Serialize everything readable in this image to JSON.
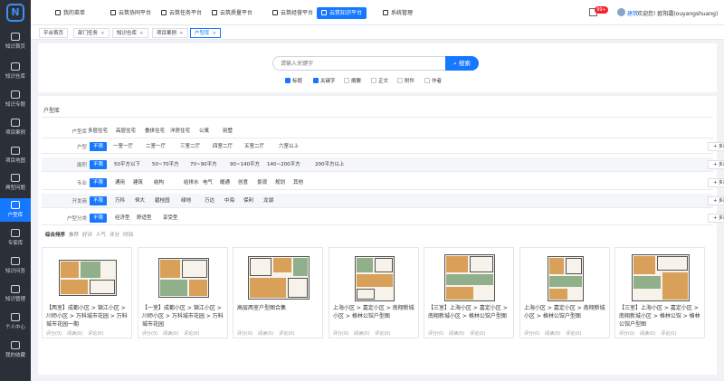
{
  "sidebar": {
    "logo": "N",
    "items": [
      {
        "label": "知识首页",
        "icon": "home-icon"
      },
      {
        "label": "知识仓库",
        "icon": "warehouse-icon"
      },
      {
        "label": "知识专题",
        "icon": "topic-icon"
      },
      {
        "label": "项目案例",
        "icon": "case-icon"
      },
      {
        "label": "项目地图",
        "icon": "map-icon"
      },
      {
        "label": "典型问题",
        "icon": "question-icon"
      },
      {
        "label": "户型库",
        "icon": "floorplan-icon",
        "active": true
      },
      {
        "label": "专家库",
        "icon": "expert-icon"
      },
      {
        "label": "知识问答",
        "icon": "qa-icon"
      },
      {
        "label": "知识管理",
        "icon": "manage-icon"
      },
      {
        "label": "个人中心",
        "icon": "user-icon"
      },
      {
        "label": "我的收藏",
        "icon": "favorite-icon"
      }
    ]
  },
  "topbar": {
    "tabs": [
      {
        "label": "我的菜单"
      },
      {
        "label": "云筑协同平台"
      },
      {
        "label": "云筑任务平台"
      },
      {
        "label": "云筑质量平台"
      },
      {
        "label": "云筑经营平台"
      },
      {
        "label": "云筑知识平台",
        "active": true
      },
      {
        "label": "系统管理"
      }
    ],
    "notify_badge": "99+",
    "user": "建筑",
    "welcome": "欢迎您! 欧阳霜(ouyangshuang)"
  },
  "breadcrumbs": [
    {
      "label": "平台首页",
      "closable": false
    },
    {
      "label": "部门任务",
      "closable": true
    },
    {
      "label": "知识仓库",
      "closable": true
    },
    {
      "label": "项目案例",
      "closable": true
    },
    {
      "label": "户型库",
      "closable": true,
      "active": true
    }
  ],
  "search": {
    "placeholder": "请输入关键字",
    "button": "搜索",
    "options": [
      {
        "label": "标题",
        "checked": true
      },
      {
        "label": "关键字",
        "checked": true
      },
      {
        "label": "摘要",
        "checked": false
      },
      {
        "label": "正文",
        "checked": false
      },
      {
        "label": "附件",
        "checked": false
      },
      {
        "label": "作者",
        "checked": false
      }
    ]
  },
  "panel": {
    "title": "户型库",
    "more_label": "+ 多选",
    "filters": [
      {
        "label": "户型库",
        "options": [
          "多层住宅",
          "高层住宅",
          "叠拼住宅",
          "洋房住宅",
          "公寓",
          "别墅"
        ],
        "selected": -1
      },
      {
        "label": "户型",
        "options": [
          "不限",
          "一室一厅",
          "二室一厅",
          "三室二厅",
          "四室二厅",
          "五室二厅",
          "六室以上"
        ],
        "selected": 0,
        "more": true
      },
      {
        "label": "面积",
        "options": [
          "不限",
          "50平方以下",
          "50~70平方",
          "70~90平方",
          "90~140平方",
          "140~200平方",
          "200平方以上"
        ],
        "selected": 0,
        "more": true
      },
      {
        "label": "专业",
        "options": [
          "不限",
          "通用",
          "建筑",
          "结构",
          "给排水",
          "电气",
          "暖通",
          "创意",
          "景观",
          "规划",
          "其他"
        ],
        "selected": 0,
        "more": true
      },
      {
        "label": "开发商",
        "options": [
          "不限",
          "万科",
          "恒大",
          "碧桂园",
          "绿地",
          "万达",
          "中海",
          "保利",
          "龙湖"
        ],
        "selected": 0,
        "more": true
      },
      {
        "label": "户型分类",
        "options": [
          "不限",
          "经济型",
          "舒适型",
          "享受型"
        ],
        "selected": 0,
        "more": true
      }
    ],
    "sort": [
      "综合排序",
      "推荐",
      "好评",
      "人气",
      "评分",
      "时间"
    ]
  },
  "cards": [
    {
      "title": "【两室】成都小区 > 锦江小区 > 川师小区 > 万科城市花园 > 万科城市花园一期",
      "meta": [
        "评分(0)",
        "阅读(0)",
        "评论(0)"
      ]
    },
    {
      "title": "【一室】成都小区 > 锦江小区 > 川师小区 > 万科城市花园 > 万科城市花园",
      "meta": [
        "评分(0)",
        "阅读(0)",
        "评论(0)"
      ]
    },
    {
      "title": "高层两室户型图合集",
      "meta": [
        "评分(0)",
        "阅读(0)",
        "评论(0)"
      ]
    },
    {
      "title": "上海小区 > 嘉定小区 > 南翔新城小区 > 格林公馆户型图",
      "meta": [
        "评分(0)",
        "阅读(0)",
        "评论(0)"
      ]
    },
    {
      "title": "【三室】上海小区 > 嘉定小区 > 南翔新城小区 > 格林公馆户型图",
      "meta": [
        "评分(0)",
        "阅读(0)",
        "评论(0)"
      ]
    },
    {
      "title": "上海小区 > 嘉定小区 > 南翔新城小区 > 格林公馆户型图",
      "meta": [
        "评分(0)",
        "阅读(0)",
        "评论(0)"
      ]
    },
    {
      "title": "【三室】上海小区 > 嘉定小区 > 南翔新城小区 > 格林公馆 > 格林公馆户型图",
      "meta": [
        "评分(0)",
        "阅读(0)",
        "评论(0)"
      ]
    }
  ]
}
